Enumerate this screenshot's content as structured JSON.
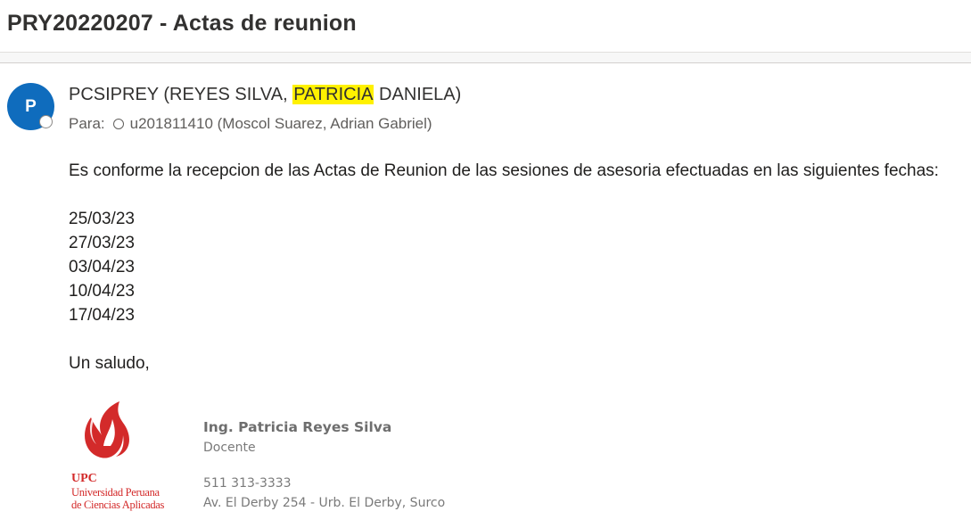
{
  "email": {
    "subject": "PRY20220207 - Actas de reunion",
    "avatar_initial": "P",
    "sender": {
      "prefix": "PCSIPREY (REYES SILVA, ",
      "highlight": "PATRICIA",
      "suffix": " DANIELA)"
    },
    "to_label": "Para:",
    "to_recipient": "u201811410 (Moscol Suarez, Adrian Gabriel)",
    "body": {
      "intro": "Es conforme la recepcion de las Actas de Reunion de las sesiones de asesoria efectuadas en las siguientes fechas:",
      "dates": [
        "25/03/23",
        "27/03/23",
        "03/04/23",
        "10/04/23",
        "17/04/23"
      ],
      "closing": "Un saludo,"
    },
    "signature": {
      "logo_abbr": "UPC",
      "logo_line1": "Universidad Peruana",
      "logo_line2": "de Ciencias Aplicadas",
      "name": "Ing. Patricia Reyes Silva",
      "role": "Docente",
      "phone": "511 313-3333",
      "address": "Av. El Derby 254 -  Urb. El Derby, Surco"
    }
  },
  "colors": {
    "avatar": "#0f6cbd",
    "highlight": "#fff100",
    "upc_red": "#d32a2a"
  }
}
